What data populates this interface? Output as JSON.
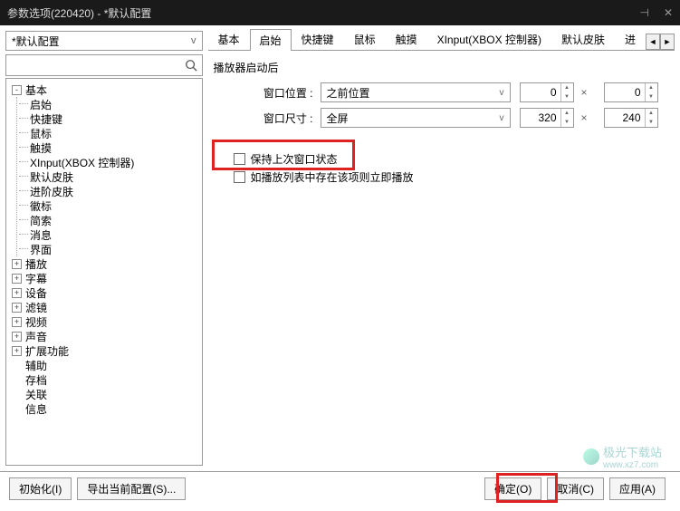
{
  "title": "参数选项(220420) - *默认配置",
  "config_selector": {
    "value": "*默认配置",
    "arrow": "v"
  },
  "search": {
    "placeholder": ""
  },
  "tree": {
    "root1": {
      "label": "基本",
      "toggle": "-",
      "children": [
        "启始",
        "快捷键",
        "鼠标",
        "触摸",
        "XInput(XBOX 控制器)",
        "默认皮肤",
        "进阶皮肤",
        "徽标",
        "简索",
        "消息",
        "界面"
      ]
    },
    "siblings": [
      {
        "label": "播放",
        "toggle": "+"
      },
      {
        "label": "字幕",
        "toggle": "+"
      },
      {
        "label": "设备",
        "toggle": "+"
      },
      {
        "label": "滤镜",
        "toggle": "+"
      },
      {
        "label": "视频",
        "toggle": "+"
      },
      {
        "label": "声音",
        "toggle": "+"
      },
      {
        "label": "扩展功能",
        "toggle": "+"
      },
      {
        "label": "辅助",
        "toggle": ""
      },
      {
        "label": "存档",
        "toggle": ""
      },
      {
        "label": "关联",
        "toggle": ""
      },
      {
        "label": "信息",
        "toggle": ""
      }
    ]
  },
  "tabs": [
    "基本",
    "启始",
    "快捷键",
    "鼠标",
    "触摸",
    "XInput(XBOX 控制器)",
    "默认皮肤",
    "进"
  ],
  "active_tab_index": 1,
  "tab_arrows": {
    "left": "◄",
    "right": "►"
  },
  "content": {
    "group_label": "播放器启动后",
    "row1": {
      "label": "窗口位置 :",
      "select": "之前位置",
      "arrow": "v",
      "val1": "0",
      "val2": "0",
      "spin_up": "▲",
      "spin_down": "▼",
      "mult": "×"
    },
    "row2": {
      "label": "窗口尺寸 :",
      "select": "全屏",
      "arrow": "v",
      "val1": "320",
      "val2": "240",
      "spin_up": "▲",
      "spin_down": "▼",
      "mult": "×"
    },
    "check1": "保持上次窗口状态",
    "check2": "如播放列表中存在该项则立即播放"
  },
  "footer": {
    "init": "初始化(I)",
    "export": "导出当前配置(S)...",
    "ok": "确定(O)",
    "cancel": "取消(C)",
    "apply": "应用(A)"
  },
  "watermark": {
    "text": "极光下载站",
    "url": "www.xz7.com"
  },
  "icons": {
    "pin": "⊣",
    "close": "✕"
  }
}
